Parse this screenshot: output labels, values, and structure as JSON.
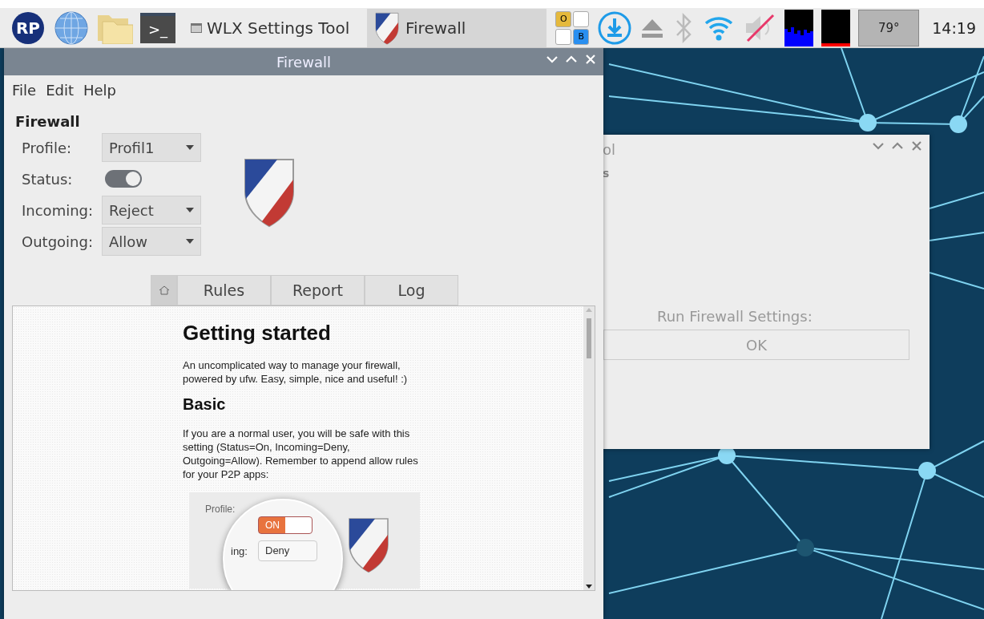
{
  "taskbar": {
    "launchers": [
      {
        "kind": "logo",
        "label": "RP"
      },
      {
        "kind": "globe"
      },
      {
        "kind": "folder"
      },
      {
        "kind": "terminal",
        "label": ">_"
      }
    ],
    "tasks": [
      {
        "title": "WLX Settings Tool",
        "kind": "window",
        "selected": false
      },
      {
        "title": "Firewall",
        "kind": "shield",
        "selected": true
      }
    ],
    "tray": {
      "keyboard": {
        "keys": [
          "O",
          "B"
        ]
      },
      "temperature": "79°",
      "clock": "14:19"
    }
  },
  "firewall_window": {
    "title": "Firewall",
    "menu": [
      "File",
      "Edit",
      "Help"
    ],
    "heading": "Firewall",
    "fields": [
      {
        "label": "Profile:",
        "kind": "dropdown",
        "value": "Profil1"
      },
      {
        "label": "Status:",
        "kind": "toggle",
        "on": true
      },
      {
        "label": "Incoming:",
        "kind": "dropdown",
        "value": "Reject"
      },
      {
        "label": "Outgoing:",
        "kind": "dropdown",
        "value": "Allow"
      }
    ],
    "tabs": [
      {
        "kind": "home",
        "selected": true
      },
      {
        "kind": "text",
        "label": "Rules",
        "selected": false
      },
      {
        "kind": "text",
        "label": "Report",
        "selected": false
      },
      {
        "kind": "text",
        "label": "Log",
        "selected": false
      }
    ],
    "help": {
      "title": "Getting started",
      "intro": "An uncomplicated way to manage your firewall, powered by ufw. Easy, simple, nice and useful! :)",
      "section": "Basic",
      "text": "If you are a normal user, you will be safe with this setting (Status=On, Incoming=Deny, Outgoing=Allow). Remember to append allow rules for your P2P apps:",
      "illustration": {
        "profile_label": "Profile:",
        "toggle_label": "ON",
        "toggle_on": true,
        "incoming_label": "ing:",
        "incoming_value": "Deny"
      }
    }
  },
  "background_window": {
    "title": "ol",
    "label": "s",
    "prompt": "Run Firewall Settings:",
    "button": "OK"
  }
}
